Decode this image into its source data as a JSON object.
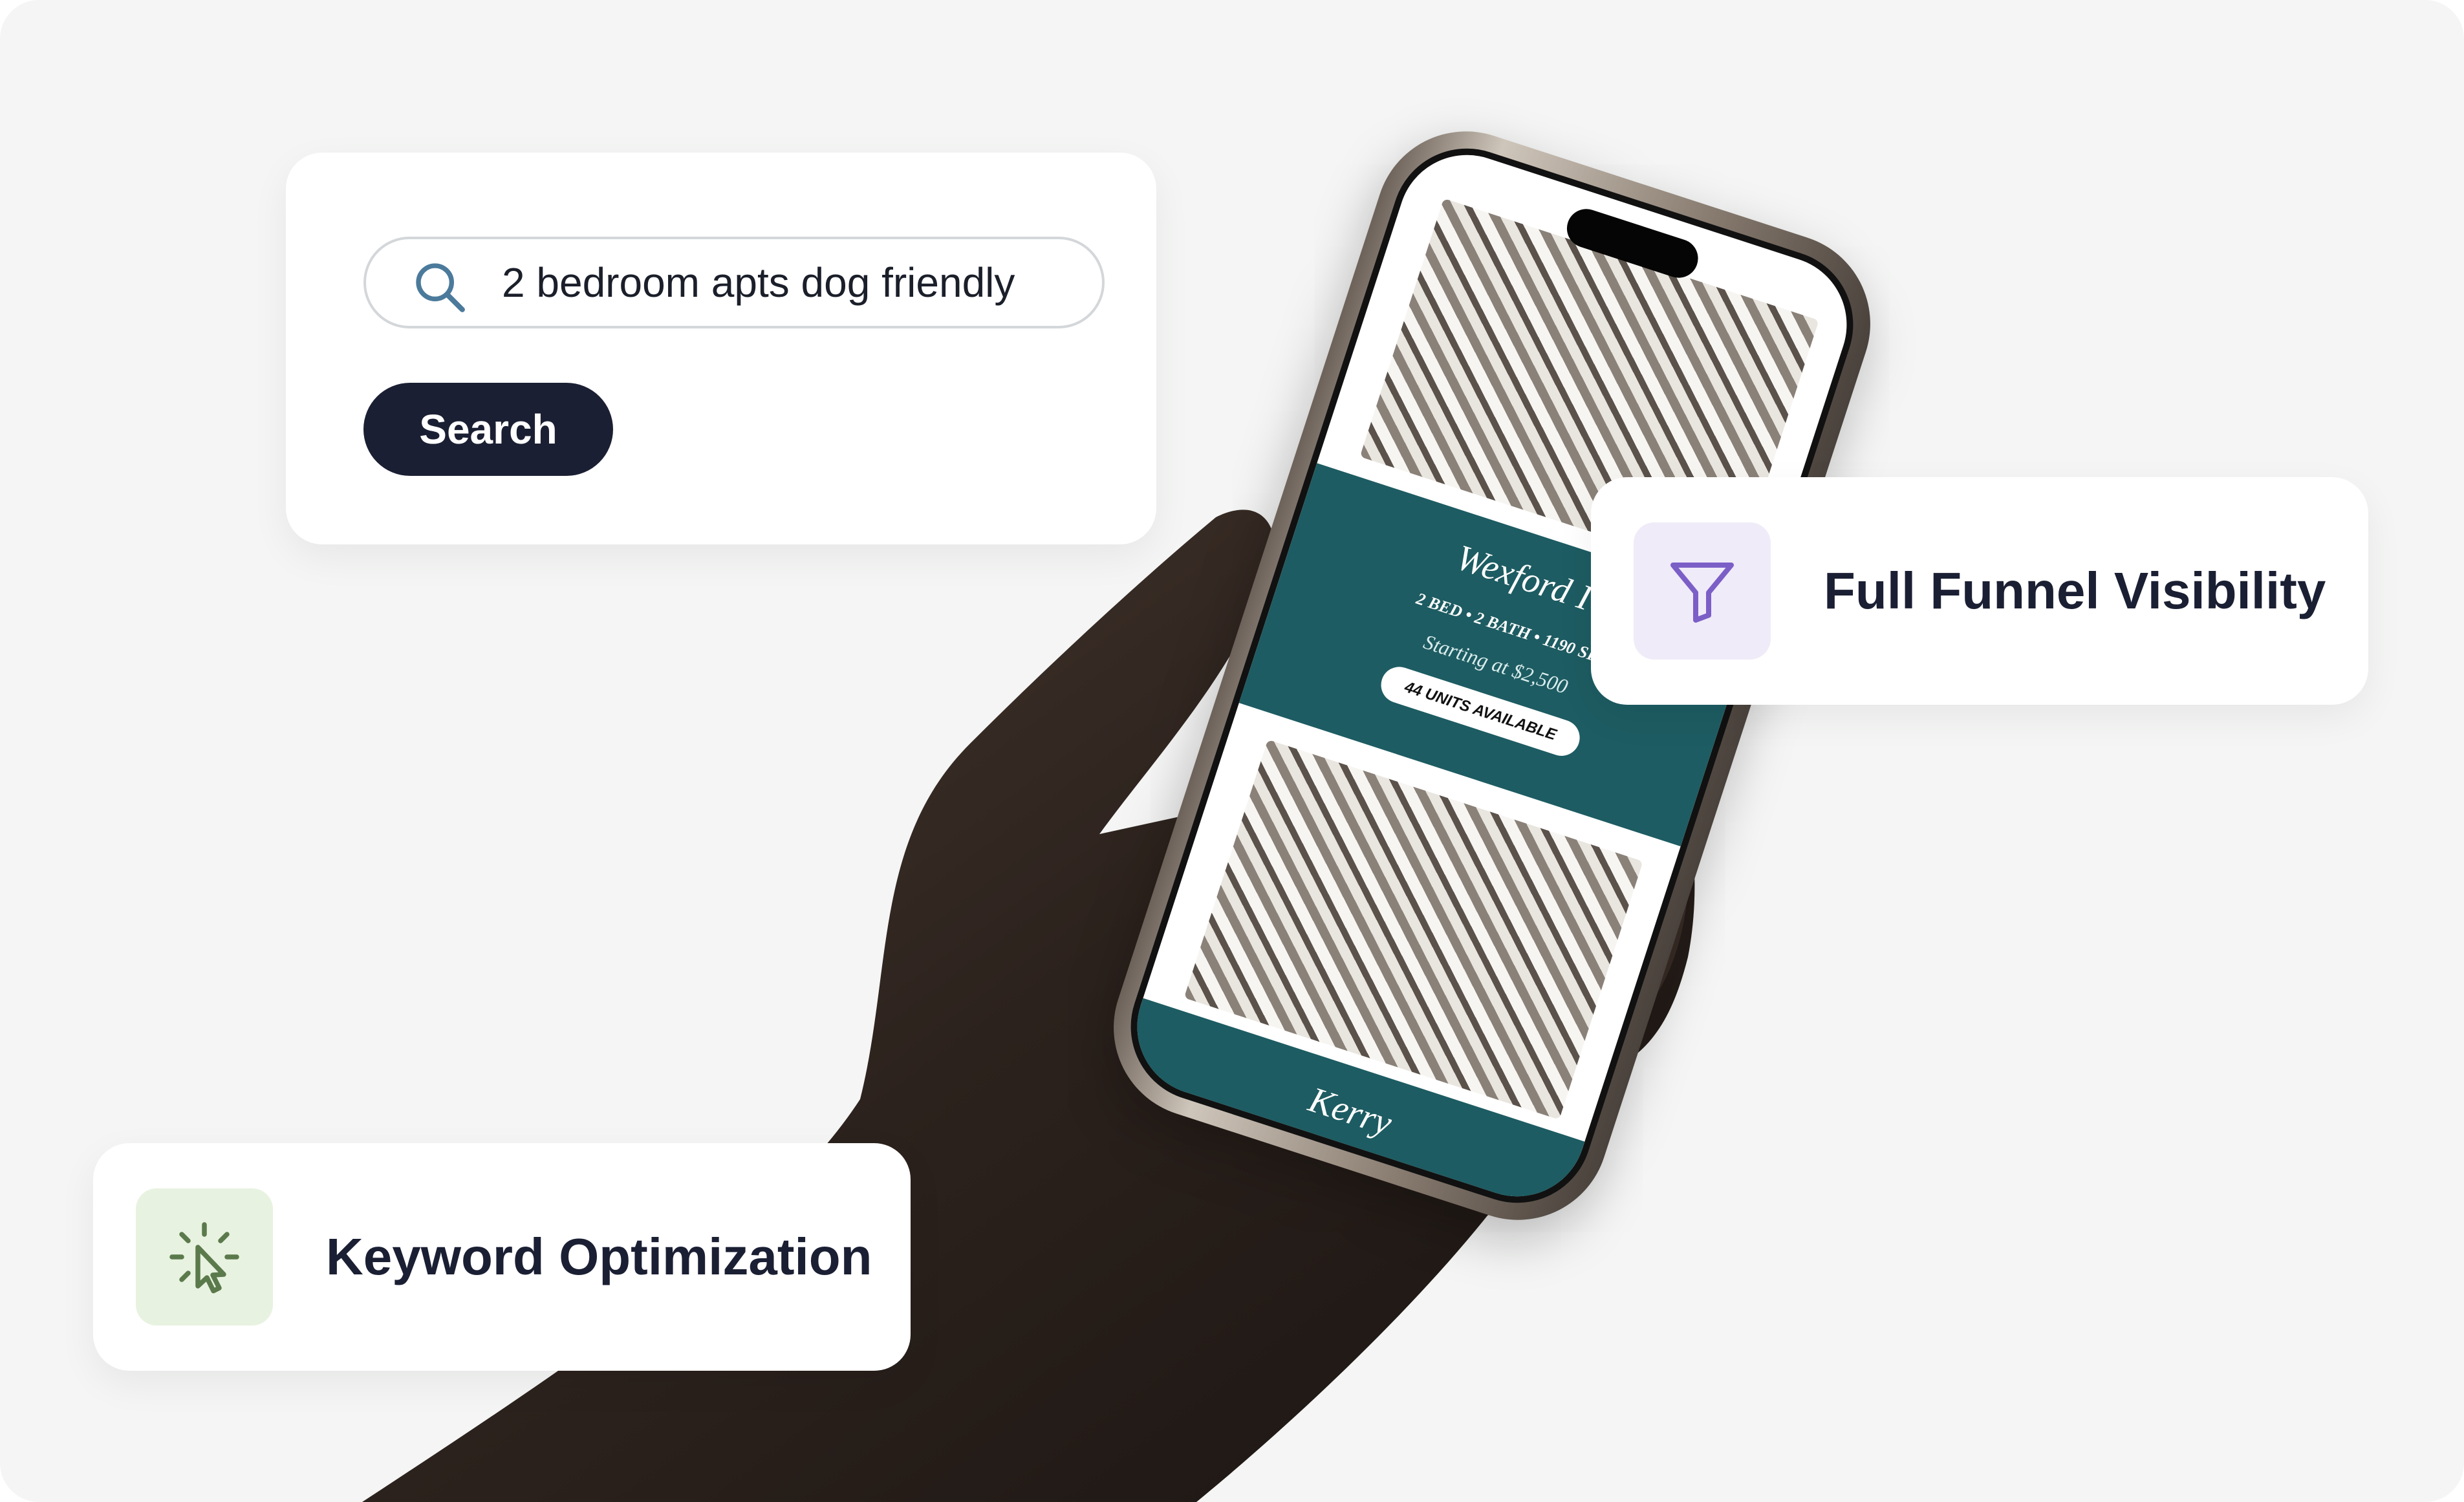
{
  "search": {
    "query": "2 bedroom apts dog friendly",
    "button_label": "Search"
  },
  "features": {
    "funnel": {
      "label": "Full Funnel Visibility",
      "icon": "funnel-icon"
    },
    "keyword": {
      "label": "Keyword Optimization",
      "icon": "cursor-click-icon"
    }
  },
  "phone": {
    "plans": [
      {
        "name": "Wexford I",
        "specs": "2 BED • 2 BATH • 1190 SF",
        "price": "Starting at $2,500",
        "units": "44 UNITS AVAILABLE"
      },
      {
        "name": "Kerry"
      }
    ]
  },
  "colors": {
    "background": "#f4f5f4",
    "button": "#1b1f33",
    "plan_banner": "#1d5c62",
    "funnel_tile": "#efebf8",
    "funnel_icon": "#7b5fc7",
    "keyword_tile": "#e8f2e0",
    "keyword_icon": "#5b7a4c"
  }
}
